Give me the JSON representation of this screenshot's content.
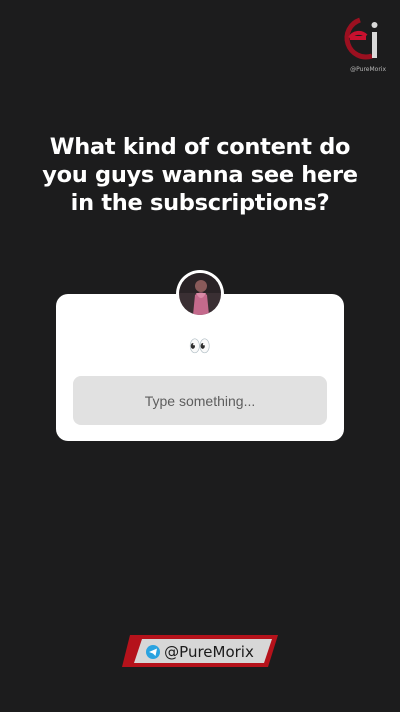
{
  "brand": {
    "logo_text": "ei",
    "logo_subtext": "@PureMorix"
  },
  "question": {
    "text": "What kind of content do you guys wanna see here in the subscriptions?"
  },
  "question_sticker": {
    "emoji": "👀",
    "input_placeholder": "Type something...",
    "avatar": "profile-avatar"
  },
  "footer": {
    "handle": "@PureMorix",
    "icon": "telegram-icon"
  },
  "colors": {
    "background": "#1c1c1d",
    "card": "#ffffff",
    "input": "#e1e1e1",
    "accent_red": "#c8102e",
    "telegram_blue": "#2aa3e0"
  }
}
